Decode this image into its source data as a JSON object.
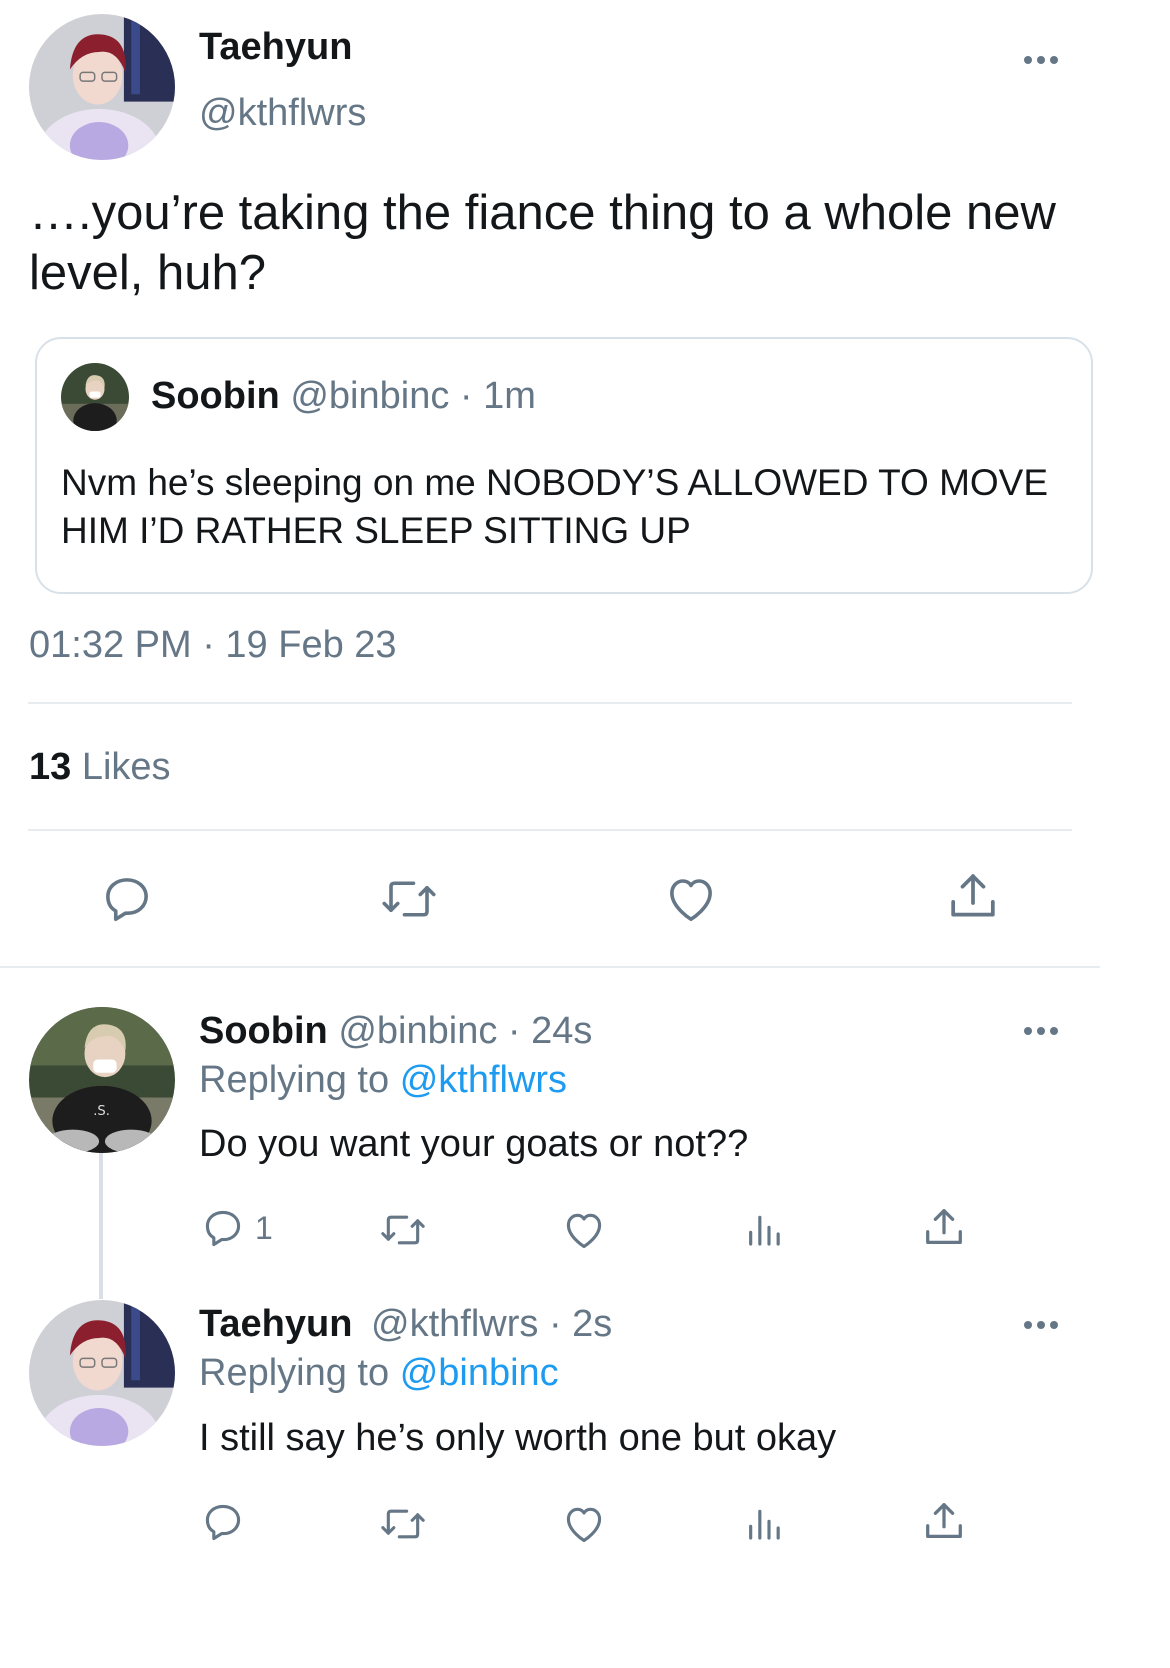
{
  "main_tweet": {
    "author": {
      "name": "Taehyun",
      "handle": "@kthflwrs"
    },
    "text": "….you’re taking the fiance thing to a whole new level, huh?",
    "quoted": {
      "name": "Soobin",
      "handle": "@binbinc",
      "sep": "·",
      "time": "1m",
      "text": "Nvm he’s sleeping on me NOBODY’S ALLOWED TO MOVE HIM I’D RATHER SLEEP SITTING UP"
    },
    "timestamp": "01:32 PM · 19 Feb 23",
    "likes_count": "13",
    "likes_label": "Likes"
  },
  "replies": [
    {
      "name": "Soobin",
      "handle": "@binbinc",
      "sep": "·",
      "time": "24s",
      "replying_label": "Replying to",
      "replying_to": "@kthflwrs",
      "text": "Do you want your goats or not??",
      "reply_count": "1"
    },
    {
      "name": "Taehyun",
      "handle": "@kthflwrs",
      "sep": "·",
      "time": "2s",
      "replying_label": "Replying to",
      "replying_to": "@binbinc",
      "text": "I still say he’s only worth one but okay",
      "reply_count": ""
    }
  ],
  "icons": {
    "more": "more-horizontal-icon",
    "reply": "reply-bubble-icon",
    "retweet": "retweet-icon",
    "like": "heart-icon",
    "analytics": "bar-chart-icon",
    "share": "share-upload-icon"
  },
  "colors": {
    "text": "#14171a",
    "muted": "#657786",
    "link": "#1d9bf0",
    "divider": "#e6ecf0",
    "avatar_taehyun_hair": "#8b1f2e",
    "avatar_soobin_bg": "#3b4a35"
  }
}
